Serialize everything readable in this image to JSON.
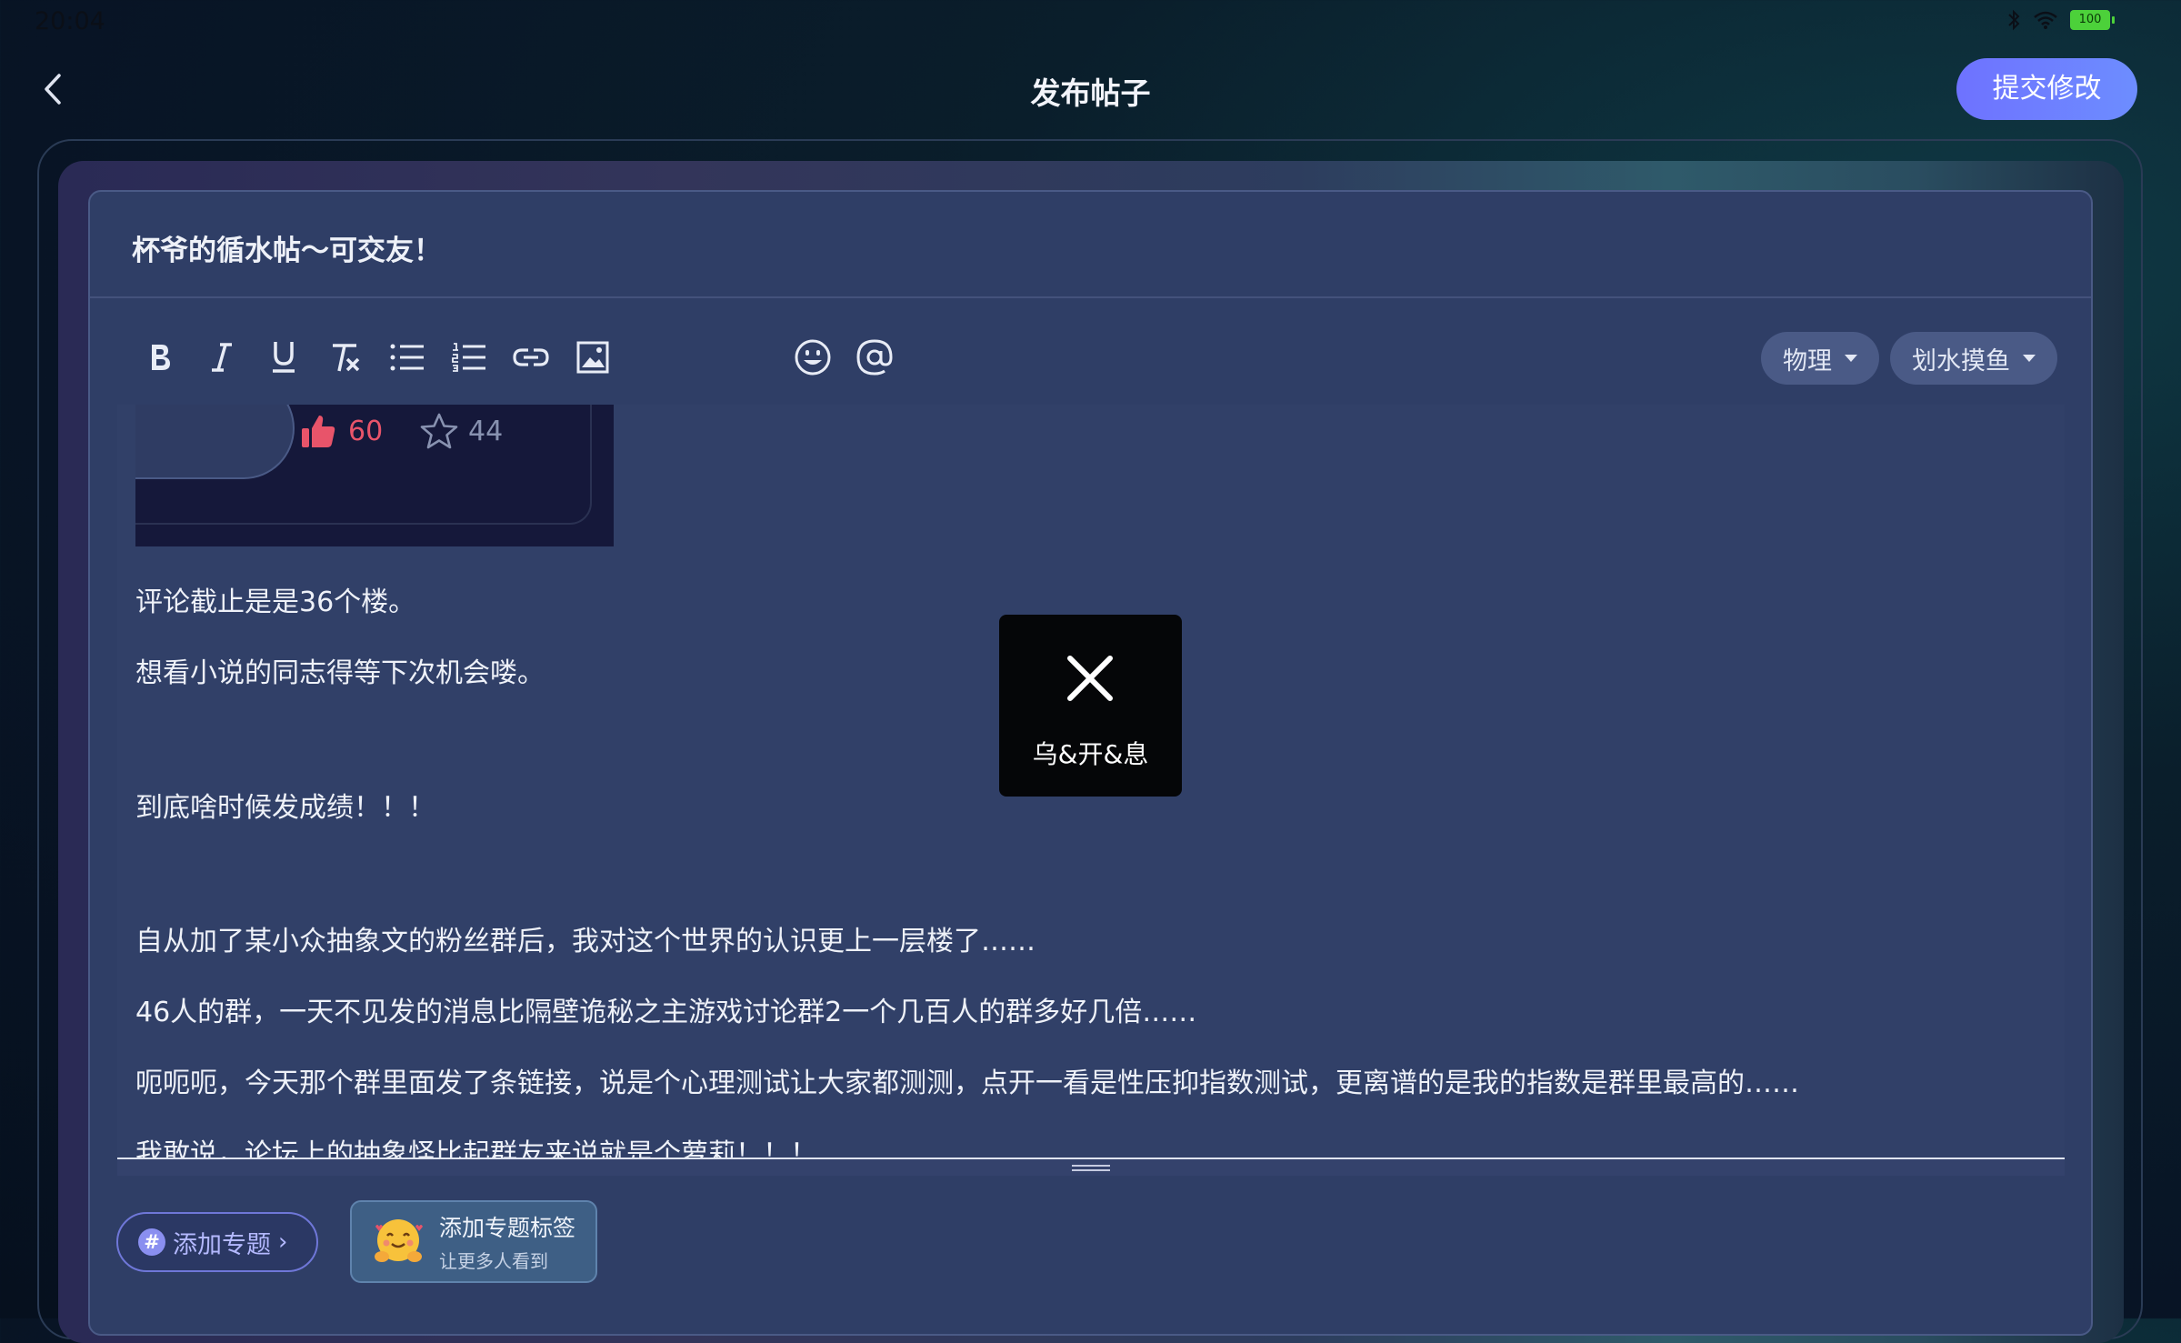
{
  "status_bar": {
    "time": "20:04",
    "battery": "100"
  },
  "header": {
    "title": "发布帖子",
    "submit_label": "提交修改"
  },
  "post": {
    "title": "杯爷的循水帖～可交友！"
  },
  "tags": {
    "category": "物理",
    "subcategory": "划水摸鱼"
  },
  "embed": {
    "likes": "60",
    "stars": "44"
  },
  "content": {
    "lines": [
      "评论截止是是36个楼。",
      "想看小说的同志得等下次机会喽。",
      "到底啥时候发成绩！！！",
      "自从加了某小众抽象文的粉丝群后，我对这个世界的认识更上一层楼了……",
      "46人的群，一天不见发的消息比隔壁诡秘之主游戏讨论群2一个几百人的群多好几倍……",
      "呃呃呃，今天那个群里面发了条链接，说是个心理测试让大家都测测，点开一看是性压抑指数测试，更离谱的是我的指数是群里最高的……",
      "我敢说，论坛上的抽象怪比起群友来说就是个萝莉！！！"
    ]
  },
  "footer": {
    "topic_label": "添加专题",
    "hint_title": "添加专题标签",
    "hint_sub": "让更多人看到"
  },
  "toast": {
    "text": "乌&开&息"
  },
  "colors": {
    "accent": "#6e72ff",
    "like": "#e8546a",
    "editor_bg": "#314068"
  },
  "icons": [
    "back-icon",
    "bold-icon",
    "italic-icon",
    "underline-icon",
    "clear-format-icon",
    "bullet-list-icon",
    "numbered-list-icon",
    "link-icon",
    "image-icon",
    "emoji-icon",
    "mention-icon",
    "thumbs-up-icon",
    "star-icon",
    "close-icon"
  ]
}
